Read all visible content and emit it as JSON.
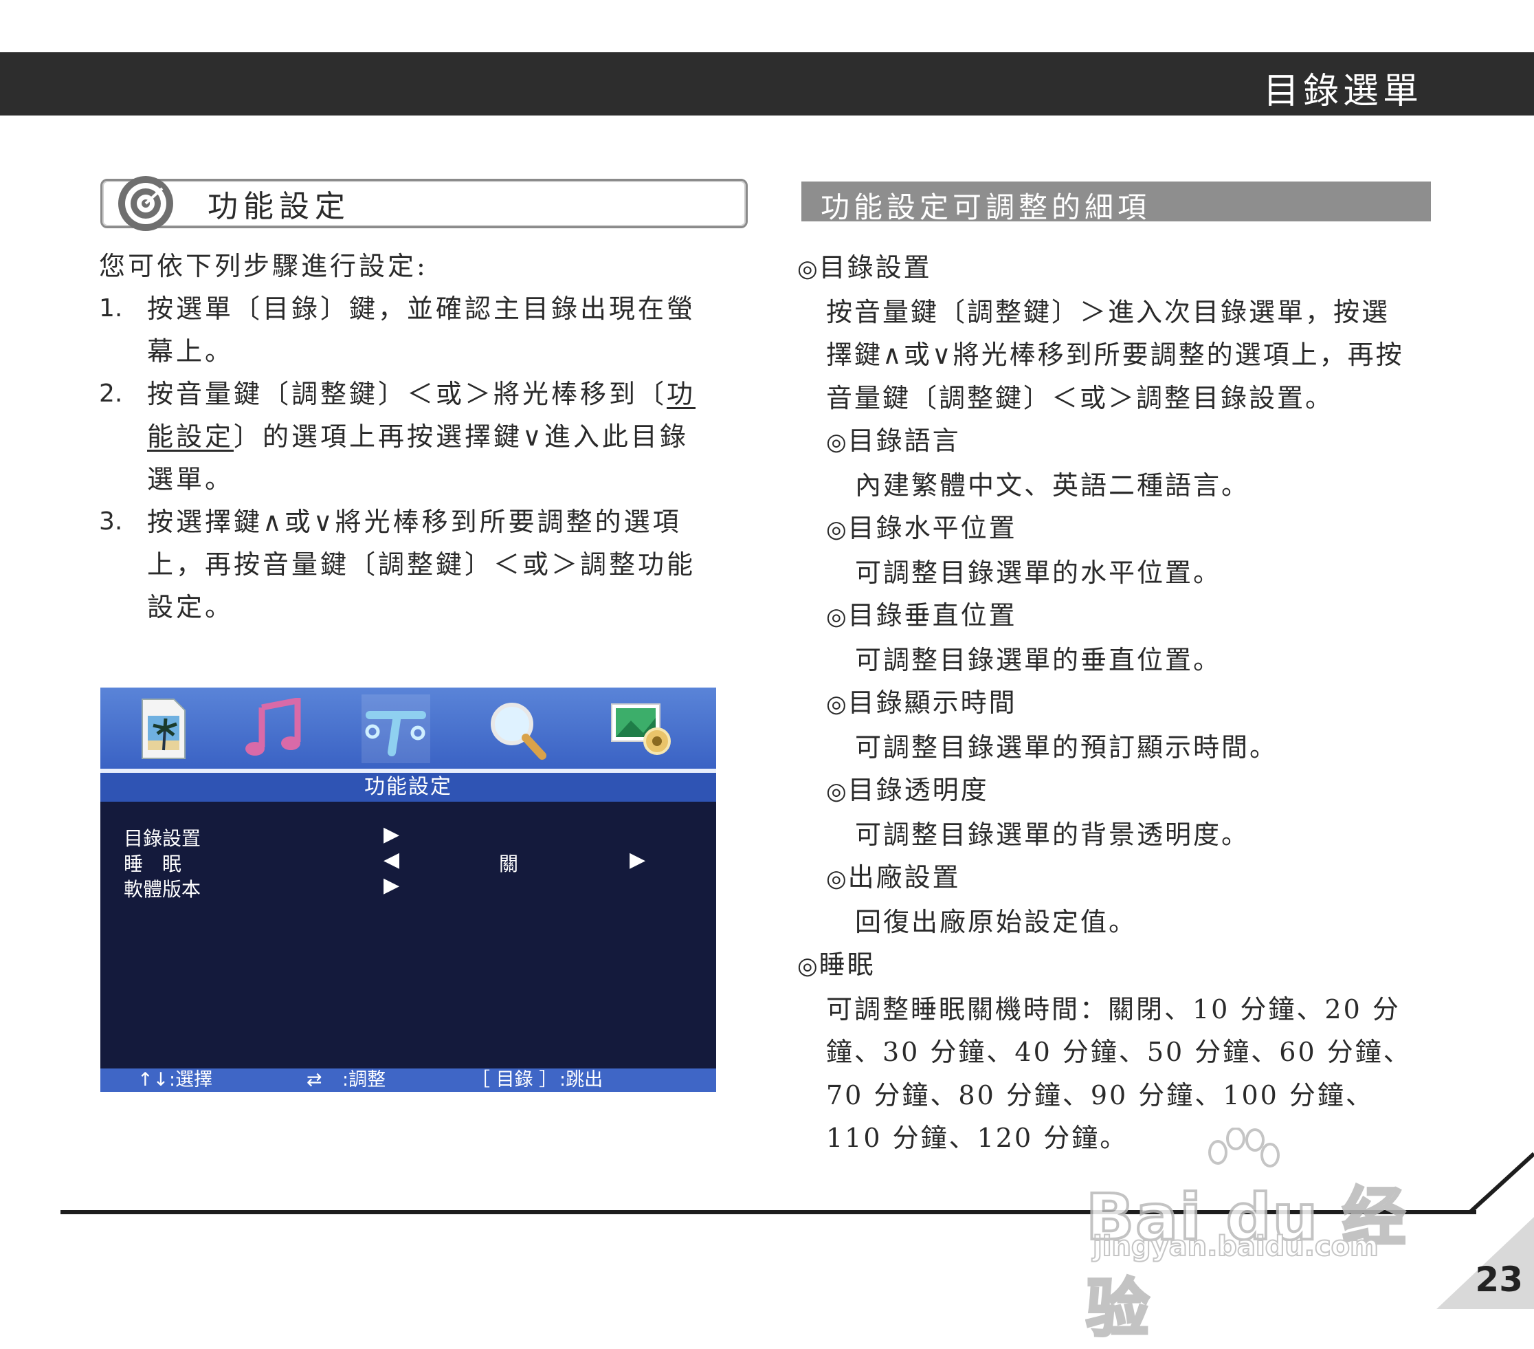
{
  "header": {
    "title": "目錄選單"
  },
  "section": {
    "title": "功能設定"
  },
  "left": {
    "intro": "您可依下列步驟進行設定:",
    "steps": [
      {
        "num": "1.",
        "text": "按選單〔目錄〕鍵，並確認主目錄出現在螢幕上。"
      },
      {
        "num": "2.",
        "text_a": "按音量鍵〔調整鍵〕＜或＞將光棒移到〔",
        "text_u": "功能設定",
        "text_b": "〕的選項上再按選擇鍵∨進入此目錄選單。"
      },
      {
        "num": "3.",
        "text": "按選擇鍵∧或∨將光棒移到所要調整的選項上，再按音量鍵〔調整鍵〕＜或＞調整功能設定。"
      }
    ]
  },
  "tv": {
    "icons": [
      "photo-icon",
      "music-icon",
      "tools-icon",
      "search-icon",
      "settings-image-icon"
    ],
    "selected_icon": "tools-icon",
    "title": "功能設定",
    "rows": [
      {
        "label": "目錄設置",
        "arrow": "▶"
      },
      {
        "label": "睡　眠",
        "left_arrow": "◀",
        "value": "關",
        "right_arrow": "▶"
      },
      {
        "label": "軟體版本",
        "arrow": "▶"
      }
    ],
    "footer": {
      "select_sym": "↑↓",
      "select_label": ":選擇",
      "adjust_sym": "⇄",
      "adjust_label": ":調整",
      "menu_sym": "［ 目錄 ］",
      "menu_label": ":跳出"
    },
    "colors": {
      "bar": "#3a62c4",
      "body": "#141a3c",
      "footer": "#3f66c6"
    }
  },
  "right": {
    "heading": "功能設定可調整的細項",
    "bullet_symbol": "◎",
    "menu_setting": {
      "title": "目錄設置",
      "desc": "按音量鍵〔調整鍵〕＞進入次目錄選單，按選擇鍵∧或∨將光棒移到所要調整的選項上，再按音量鍵〔調整鍵〕＜或＞調整目錄設置。",
      "items": [
        {
          "title": "目錄語言",
          "desc": "內建繁體中文、英語二種語言。"
        },
        {
          "title": "目錄水平位置",
          "desc": "可調整目錄選單的水平位置。"
        },
        {
          "title": "目錄垂直位置",
          "desc": "可調整目錄選單的垂直位置。"
        },
        {
          "title": "目錄顯示時間",
          "desc": "可調整目錄選單的預訂顯示時間。"
        },
        {
          "title": "目錄透明度",
          "desc": "可調整目錄選單的背景透明度。"
        },
        {
          "title": "出廠設置",
          "desc": "回復出廠原始設定值。"
        }
      ]
    },
    "sleep": {
      "title": "睡眠",
      "desc": "可調整睡眠關機時間：關閉、10 分鐘、20 分鐘、30 分鐘、40 分鐘、50 分鐘、60 分鐘、70 分鐘、80 分鐘、90 分鐘、100 分鐘、110 分鐘、120 分鐘。"
    }
  },
  "page_number": "23",
  "watermark": {
    "text": "Bai du 经验",
    "sub": "jingyan.baidu.com"
  }
}
